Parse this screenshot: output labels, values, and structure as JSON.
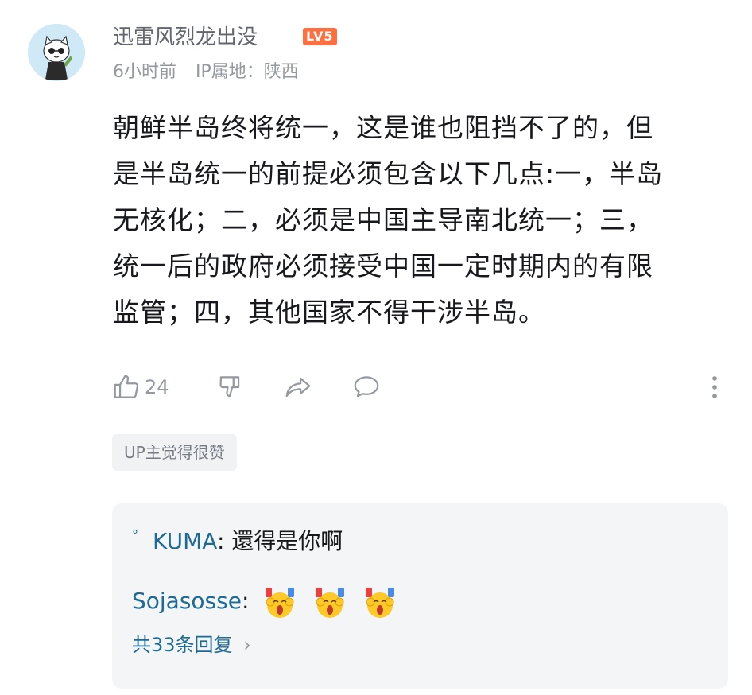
{
  "comment": {
    "username": "迅雷风烈龙出没",
    "level": "LV5",
    "time": "6小时前",
    "ip_location": "IP属地：陕西",
    "lines": [
      "朝鲜半岛终将统一，这是谁也阻挡不了的，但",
      "是半岛统一的前提必须包含以下几点:一，半岛",
      "无核化；二，必须是中国主导南北统一；三，",
      "统一后的政府必须接受中国一定时期内的有限",
      "监管；四，其他国家不得干涉半岛。"
    ],
    "like_count": "24",
    "icons": [
      "thumb-up-icon",
      "thumb-down-icon",
      "share-icon",
      "comment-icon",
      "more-icon"
    ],
    "up_tag": "UP主觉得很赞"
  },
  "replies": {
    "items": [
      {
        "name": "KUMA",
        "text": "還得是你啊",
        "prefix": "°"
      },
      {
        "name": "Sojasosse",
        "text": ""
      }
    ],
    "more_label": "共33条回复",
    "more_arrow": "›"
  },
  "colors": {
    "link": "#1d6a96",
    "secondary": "#9499a0",
    "level_badge": "#ff6f3f"
  }
}
